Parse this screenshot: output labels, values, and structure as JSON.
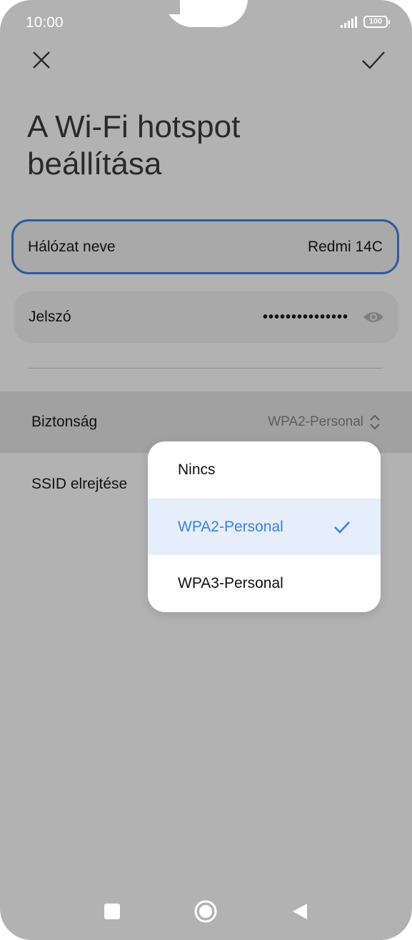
{
  "status_bar": {
    "time": "10:00",
    "battery": "100"
  },
  "header": {
    "close_icon": "close-icon",
    "confirm_icon": "check-icon"
  },
  "page": {
    "title": "A Wi-Fi hotspot beállítása"
  },
  "fields": {
    "network_name": {
      "label": "Hálózat neve",
      "value": "Redmi 14C"
    },
    "password": {
      "label": "Jelszó",
      "value": "•••••••••••••••"
    }
  },
  "security": {
    "label": "Biztonság",
    "value": "WPA2-Personal"
  },
  "ssid_hide": {
    "label": "SSID elrejtése"
  },
  "dropdown": {
    "options": [
      {
        "label": "Nincs"
      },
      {
        "label": "WPA2-Personal",
        "selected": true
      },
      {
        "label": "WPA3-Personal"
      }
    ],
    "accent_color": "#3b82e0"
  },
  "navbar": {
    "items": [
      "square-icon",
      "home-icon",
      "back-icon"
    ]
  }
}
